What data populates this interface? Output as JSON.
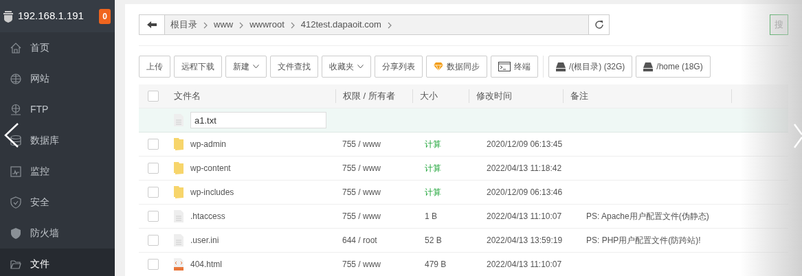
{
  "sidebar": {
    "host": "192.168.1.191",
    "badge": "0",
    "items": [
      {
        "label": "首页",
        "selected": false
      },
      {
        "label": "网站",
        "selected": false
      },
      {
        "label": "FTP",
        "selected": false
      },
      {
        "label": "数据库",
        "selected": false
      },
      {
        "label": "监控",
        "selected": false
      },
      {
        "label": "安全",
        "selected": false
      },
      {
        "label": "防火墙",
        "selected": false
      },
      {
        "label": "文件",
        "selected": true
      }
    ]
  },
  "breadcrumb": {
    "segments": [
      "根目录",
      "www",
      "wwwroot",
      "412test.dapaoit.com"
    ]
  },
  "search_button": "搜",
  "toolbar": [
    {
      "label": "上传",
      "kind": "plain"
    },
    {
      "label": "远程下载",
      "kind": "plain"
    },
    {
      "label": "新建",
      "kind": "dropdown"
    },
    {
      "label": "文件查找",
      "kind": "plain"
    },
    {
      "label": "收藏夹",
      "kind": "dropdown"
    },
    {
      "label": "分享列表",
      "kind": "plain"
    },
    {
      "label": "数据同步",
      "kind": "sync"
    },
    {
      "label": "终端",
      "kind": "terminal"
    },
    {
      "label": "/(根目录) (32G)",
      "kind": "disk"
    },
    {
      "label": "/home (18G)",
      "kind": "disk"
    }
  ],
  "table": {
    "columns": [
      "文件名",
      "权限 / 所有者",
      "大小",
      "修改时间",
      "备注"
    ],
    "select_all": {
      "checked": false
    },
    "new_row": {
      "value": "a1.txt"
    },
    "rows": [
      {
        "name": "wp-admin",
        "kind": "folder",
        "checked": false,
        "perm": "755 / www",
        "size": {
          "label": "计算",
          "kind": "link"
        },
        "time": "2020/12/09 06:13:45"
      },
      {
        "name": "wp-content",
        "kind": "folder",
        "checked": false,
        "perm": "755 / www",
        "size": {
          "label": "计算",
          "kind": "link"
        },
        "time": "2022/04/13 11:18:42"
      },
      {
        "name": "wp-includes",
        "kind": "folder",
        "checked": false,
        "perm": "755 / www",
        "size": {
          "label": "计算",
          "kind": "link"
        },
        "time": "2020/12/09 06:13:46"
      },
      {
        "name": ".htaccess",
        "kind": "file",
        "checked": false,
        "perm": "755 / www",
        "size": {
          "label": "1 B",
          "kind": "text"
        },
        "time": "2022/04/13 11:10:07",
        "note": "PS: Apache用户配置文件(伪静态)"
      },
      {
        "name": ".user.ini",
        "kind": "file",
        "checked": false,
        "perm": "644 / root",
        "size": {
          "label": "52 B",
          "kind": "text"
        },
        "time": "2022/04/13 13:59:19",
        "note": "PS: PHP用户配置文件(防跨站)!"
      },
      {
        "name": "404.html",
        "kind": "html",
        "checked": false,
        "perm": "755 / www",
        "size": {
          "label": "479 B",
          "kind": "text"
        },
        "time": "2022/04/13 11:10:07"
      }
    ]
  }
}
